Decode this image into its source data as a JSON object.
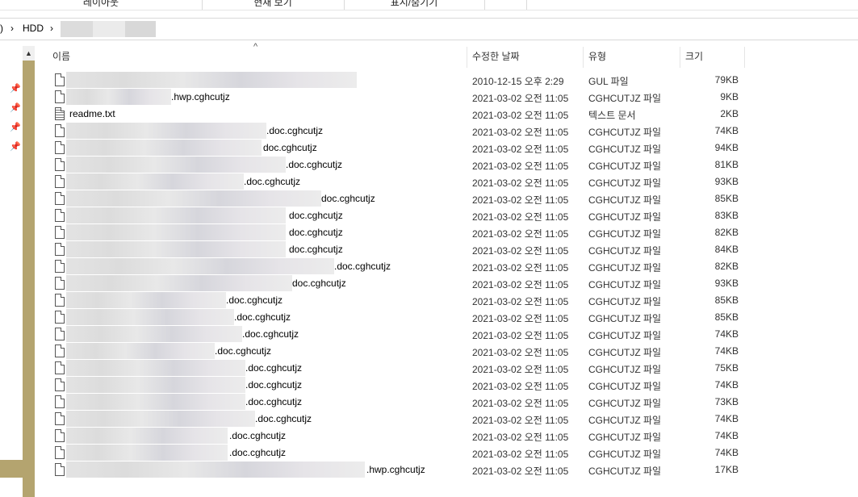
{
  "ribbon": {
    "groups": [
      "레이아웃",
      "현재 보기",
      "표시/숨기기"
    ]
  },
  "address": {
    "parts": [
      ")",
      "HDD"
    ],
    "chevrons": [
      "›",
      "›"
    ]
  },
  "columns": {
    "name": "이름",
    "date": "수정한 날짜",
    "type": "유형",
    "size": "크기"
  },
  "files": [
    {
      "name": "",
      "date": "2010-12-15 오후 2:29",
      "type": "GUL 파일",
      "size": "79KB"
    },
    {
      "name": ".hwp.cghcutjz",
      "date": "2021-03-02 오전 11:05",
      "type": "CGHCUTJZ 파일",
      "size": "9KB"
    },
    {
      "name": "readme.txt",
      "date": "2021-03-02 오전 11:05",
      "type": "텍스트 문서",
      "size": "2KB"
    },
    {
      "name": ".doc.cghcutjz",
      "date": "2021-03-02 오전 11:05",
      "type": "CGHCUTJZ 파일",
      "size": "74KB"
    },
    {
      "name": "doc.cghcutjz",
      "date": "2021-03-02 오전 11:05",
      "type": "CGHCUTJZ 파일",
      "size": "94KB"
    },
    {
      "name": ".doc.cghcutjz",
      "date": "2021-03-02 오전 11:05",
      "type": "CGHCUTJZ 파일",
      "size": "81KB"
    },
    {
      "name": ".doc.cghcutjz",
      "date": "2021-03-02 오전 11:05",
      "type": "CGHCUTJZ 파일",
      "size": "93KB"
    },
    {
      "name": "doc.cghcutjz",
      "date": "2021-03-02 오전 11:05",
      "type": "CGHCUTJZ 파일",
      "size": "85KB"
    },
    {
      "name": "doc.cghcutjz",
      "date": "2021-03-02 오전 11:05",
      "type": "CGHCUTJZ 파일",
      "size": "83KB"
    },
    {
      "name": "doc.cghcutjz",
      "date": "2021-03-02 오전 11:05",
      "type": "CGHCUTJZ 파일",
      "size": "82KB"
    },
    {
      "name": "doc.cghcutjz",
      "date": "2021-03-02 오전 11:05",
      "type": "CGHCUTJZ 파일",
      "size": "84KB"
    },
    {
      "name": ".doc.cghcutjz",
      "date": "2021-03-02 오전 11:05",
      "type": "CGHCUTJZ 파일",
      "size": "82KB"
    },
    {
      "name": "doc.cghcutjz",
      "date": "2021-03-02 오전 11:05",
      "type": "CGHCUTJZ 파일",
      "size": "93KB"
    },
    {
      "name": ".doc.cghcutjz",
      "date": "2021-03-02 오전 11:05",
      "type": "CGHCUTJZ 파일",
      "size": "85KB"
    },
    {
      "name": ".doc.cghcutjz",
      "date": "2021-03-02 오전 11:05",
      "type": "CGHCUTJZ 파일",
      "size": "85KB"
    },
    {
      "name": ".doc.cghcutjz",
      "date": "2021-03-02 오전 11:05",
      "type": "CGHCUTJZ 파일",
      "size": "74KB"
    },
    {
      "name": ".doc.cghcutjz",
      "date": "2021-03-02 오전 11:05",
      "type": "CGHCUTJZ 파일",
      "size": "74KB"
    },
    {
      "name": ".doc.cghcutjz",
      "date": "2021-03-02 오전 11:05",
      "type": "CGHCUTJZ 파일",
      "size": "75KB"
    },
    {
      "name": ".doc.cghcutjz",
      "date": "2021-03-02 오전 11:05",
      "type": "CGHCUTJZ 파일",
      "size": "74KB"
    },
    {
      "name": ".doc.cghcutjz",
      "date": "2021-03-02 오전 11:05",
      "type": "CGHCUTJZ 파일",
      "size": "73KB"
    },
    {
      "name": ".doc.cghcutjz",
      "date": "2021-03-02 오전 11:05",
      "type": "CGHCUTJZ 파일",
      "size": "74KB"
    },
    {
      "name": ".doc.cghcutjz",
      "date": "2021-03-02 오전 11:05",
      "type": "CGHCUTJZ 파일",
      "size": "74KB"
    },
    {
      "name": ".doc.cghcutjz",
      "date": "2021-03-02 오전 11:05",
      "type": "CGHCUTJZ 파일",
      "size": "74KB"
    },
    {
      "name": ".hwp.cghcutjz",
      "date": "2021-03-02 오전 11:05",
      "type": "CGHCUTJZ 파일",
      "size": "17KB"
    }
  ]
}
